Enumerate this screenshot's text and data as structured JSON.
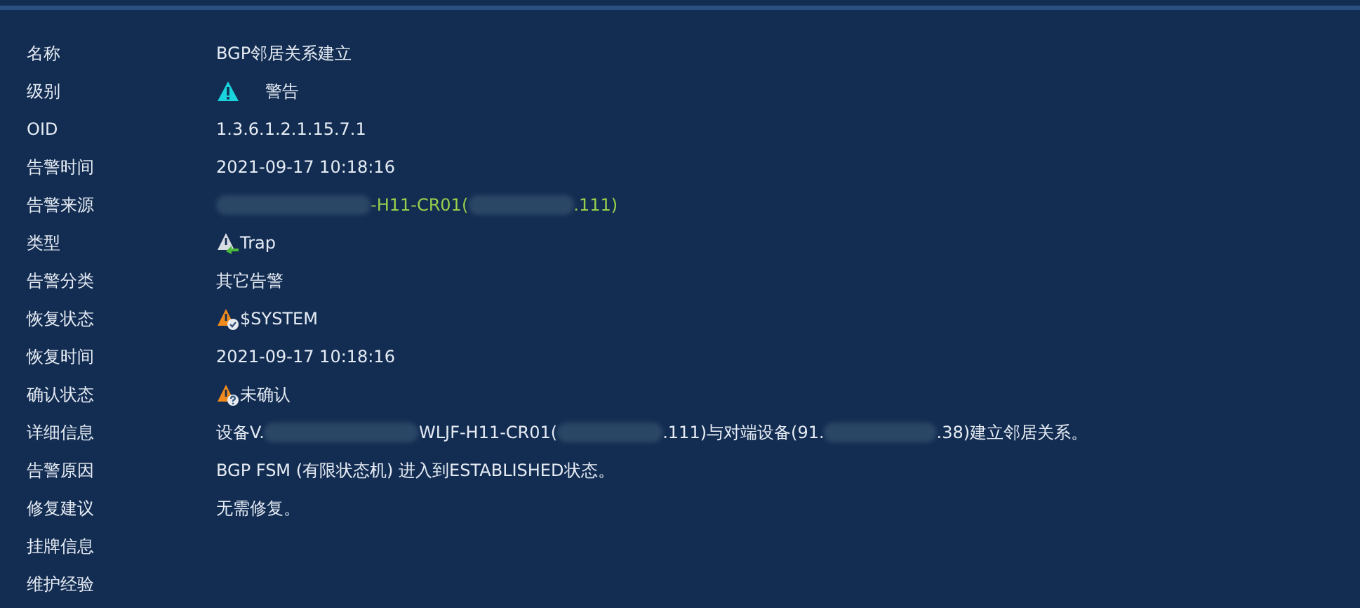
{
  "fields": [
    {
      "label": "名称",
      "value": [
        {
          "kind": "text",
          "text": "BGP邻居关系建立"
        }
      ]
    },
    {
      "label": "级别",
      "kind": "warning",
      "value": [
        {
          "kind": "text",
          "text": "警告"
        }
      ]
    },
    {
      "label": "OID",
      "value": [
        {
          "kind": "text",
          "text": "1.3.6.1.2.1.15.7.1"
        }
      ]
    },
    {
      "label": "告警时间",
      "value": [
        {
          "kind": "text",
          "text": "2021-09-17 10:18:16"
        }
      ]
    },
    {
      "label": "告警来源",
      "color": "#95d04c",
      "value": [
        {
          "kind": "redacted"
        },
        {
          "kind": "text",
          "text": "-H11-CR01("
        },
        {
          "kind": "redacted"
        },
        {
          "kind": "text",
          "text": ".111)"
        }
      ]
    },
    {
      "label": "类型",
      "kind": "trap",
      "value": [
        {
          "kind": "text",
          "text": "Trap"
        }
      ]
    },
    {
      "label": "告警分类",
      "value": [
        {
          "kind": "text",
          "text": "其它告警"
        }
      ]
    },
    {
      "label": "恢复状态",
      "kind": "recovered",
      "value": [
        {
          "kind": "text",
          "text": "$SYSTEM"
        }
      ]
    },
    {
      "label": "恢复时间",
      "value": [
        {
          "kind": "text",
          "text": "2021-09-17 10:18:16"
        }
      ]
    },
    {
      "label": "确认状态",
      "kind": "unconfirmed",
      "value": [
        {
          "kind": "text",
          "text": "未确认"
        }
      ]
    },
    {
      "label": "详细信息",
      "value": [
        {
          "kind": "text",
          "text": "设备V."
        },
        {
          "kind": "redacted"
        },
        {
          "kind": "text",
          "text": "WLJF-H11-CR01("
        },
        {
          "kind": "redacted"
        },
        {
          "kind": "text",
          "text": ".111)与对端设备(91."
        },
        {
          "kind": "redacted"
        },
        {
          "kind": "text",
          "text": ".38)建立邻居关系。"
        }
      ]
    },
    {
      "label": "告警原因",
      "value": [
        {
          "kind": "text",
          "text": "BGP FSM (有限状态机) 进入到ESTABLISHED状态。"
        }
      ]
    },
    {
      "label": "修复建议",
      "value": [
        {
          "kind": "text",
          "text": "无需修复。"
        }
      ]
    },
    {
      "label": "挂牌信息"
    },
    {
      "label": "维护经验"
    }
  ]
}
